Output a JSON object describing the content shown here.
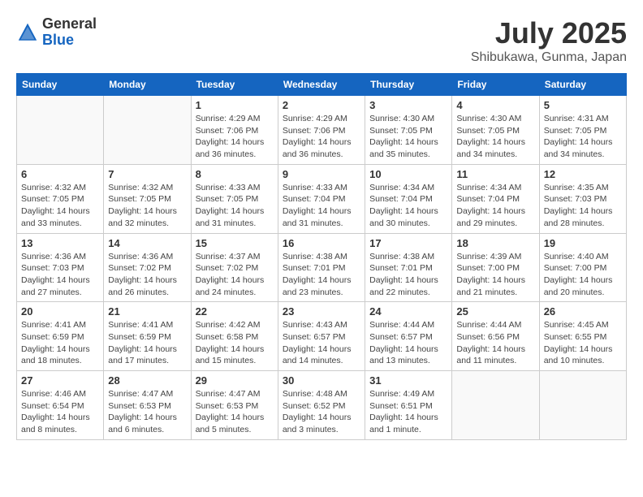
{
  "header": {
    "logo_general": "General",
    "logo_blue": "Blue",
    "month": "July 2025",
    "location": "Shibukawa, Gunma, Japan"
  },
  "days_of_week": [
    "Sunday",
    "Monday",
    "Tuesday",
    "Wednesday",
    "Thursday",
    "Friday",
    "Saturday"
  ],
  "weeks": [
    [
      {
        "day": "",
        "info": ""
      },
      {
        "day": "",
        "info": ""
      },
      {
        "day": "1",
        "info": "Sunrise: 4:29 AM\nSunset: 7:06 PM\nDaylight: 14 hours and 36 minutes."
      },
      {
        "day": "2",
        "info": "Sunrise: 4:29 AM\nSunset: 7:06 PM\nDaylight: 14 hours and 36 minutes."
      },
      {
        "day": "3",
        "info": "Sunrise: 4:30 AM\nSunset: 7:05 PM\nDaylight: 14 hours and 35 minutes."
      },
      {
        "day": "4",
        "info": "Sunrise: 4:30 AM\nSunset: 7:05 PM\nDaylight: 14 hours and 34 minutes."
      },
      {
        "day": "5",
        "info": "Sunrise: 4:31 AM\nSunset: 7:05 PM\nDaylight: 14 hours and 34 minutes."
      }
    ],
    [
      {
        "day": "6",
        "info": "Sunrise: 4:32 AM\nSunset: 7:05 PM\nDaylight: 14 hours and 33 minutes."
      },
      {
        "day": "7",
        "info": "Sunrise: 4:32 AM\nSunset: 7:05 PM\nDaylight: 14 hours and 32 minutes."
      },
      {
        "day": "8",
        "info": "Sunrise: 4:33 AM\nSunset: 7:05 PM\nDaylight: 14 hours and 31 minutes."
      },
      {
        "day": "9",
        "info": "Sunrise: 4:33 AM\nSunset: 7:04 PM\nDaylight: 14 hours and 31 minutes."
      },
      {
        "day": "10",
        "info": "Sunrise: 4:34 AM\nSunset: 7:04 PM\nDaylight: 14 hours and 30 minutes."
      },
      {
        "day": "11",
        "info": "Sunrise: 4:34 AM\nSunset: 7:04 PM\nDaylight: 14 hours and 29 minutes."
      },
      {
        "day": "12",
        "info": "Sunrise: 4:35 AM\nSunset: 7:03 PM\nDaylight: 14 hours and 28 minutes."
      }
    ],
    [
      {
        "day": "13",
        "info": "Sunrise: 4:36 AM\nSunset: 7:03 PM\nDaylight: 14 hours and 27 minutes."
      },
      {
        "day": "14",
        "info": "Sunrise: 4:36 AM\nSunset: 7:02 PM\nDaylight: 14 hours and 26 minutes."
      },
      {
        "day": "15",
        "info": "Sunrise: 4:37 AM\nSunset: 7:02 PM\nDaylight: 14 hours and 24 minutes."
      },
      {
        "day": "16",
        "info": "Sunrise: 4:38 AM\nSunset: 7:01 PM\nDaylight: 14 hours and 23 minutes."
      },
      {
        "day": "17",
        "info": "Sunrise: 4:38 AM\nSunset: 7:01 PM\nDaylight: 14 hours and 22 minutes."
      },
      {
        "day": "18",
        "info": "Sunrise: 4:39 AM\nSunset: 7:00 PM\nDaylight: 14 hours and 21 minutes."
      },
      {
        "day": "19",
        "info": "Sunrise: 4:40 AM\nSunset: 7:00 PM\nDaylight: 14 hours and 20 minutes."
      }
    ],
    [
      {
        "day": "20",
        "info": "Sunrise: 4:41 AM\nSunset: 6:59 PM\nDaylight: 14 hours and 18 minutes."
      },
      {
        "day": "21",
        "info": "Sunrise: 4:41 AM\nSunset: 6:59 PM\nDaylight: 14 hours and 17 minutes."
      },
      {
        "day": "22",
        "info": "Sunrise: 4:42 AM\nSunset: 6:58 PM\nDaylight: 14 hours and 15 minutes."
      },
      {
        "day": "23",
        "info": "Sunrise: 4:43 AM\nSunset: 6:57 PM\nDaylight: 14 hours and 14 minutes."
      },
      {
        "day": "24",
        "info": "Sunrise: 4:44 AM\nSunset: 6:57 PM\nDaylight: 14 hours and 13 minutes."
      },
      {
        "day": "25",
        "info": "Sunrise: 4:44 AM\nSunset: 6:56 PM\nDaylight: 14 hours and 11 minutes."
      },
      {
        "day": "26",
        "info": "Sunrise: 4:45 AM\nSunset: 6:55 PM\nDaylight: 14 hours and 10 minutes."
      }
    ],
    [
      {
        "day": "27",
        "info": "Sunrise: 4:46 AM\nSunset: 6:54 PM\nDaylight: 14 hours and 8 minutes."
      },
      {
        "day": "28",
        "info": "Sunrise: 4:47 AM\nSunset: 6:53 PM\nDaylight: 14 hours and 6 minutes."
      },
      {
        "day": "29",
        "info": "Sunrise: 4:47 AM\nSunset: 6:53 PM\nDaylight: 14 hours and 5 minutes."
      },
      {
        "day": "30",
        "info": "Sunrise: 4:48 AM\nSunset: 6:52 PM\nDaylight: 14 hours and 3 minutes."
      },
      {
        "day": "31",
        "info": "Sunrise: 4:49 AM\nSunset: 6:51 PM\nDaylight: 14 hours and 1 minute."
      },
      {
        "day": "",
        "info": ""
      },
      {
        "day": "",
        "info": ""
      }
    ]
  ]
}
